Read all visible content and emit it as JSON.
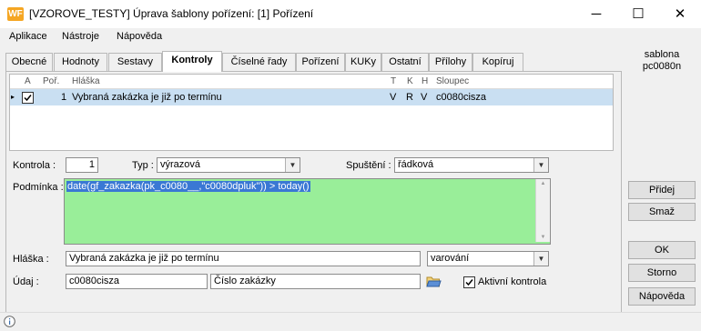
{
  "window": {
    "logo": "WF",
    "title": "[VZOROVE_TESTY] Úprava šablony pořízení: [1] Pořízení",
    "minimize": "─",
    "maximize": "☐",
    "close": "✕"
  },
  "menu": [
    "Aplikace",
    "Nástroje",
    "Nápověda"
  ],
  "tabs": [
    "Obecné",
    "Hodnoty",
    "Sestavy",
    "Kontroly",
    "Číselné řady",
    "Pořízení",
    "KUKy",
    "Ostatní",
    "Přílohy",
    "Kopíruj"
  ],
  "active_tab": "Kontroly",
  "side_info": {
    "line1": "sablona",
    "line2": "pc0080n"
  },
  "grid": {
    "headers": {
      "a": "A",
      "por": "Poř.",
      "hlaska": "Hláška",
      "t": "T",
      "k": "K",
      "h": "H",
      "sloupec": "Sloupec"
    },
    "rows": [
      {
        "marker": "▸",
        "checked": true,
        "por": "1",
        "hlaska": "Vybraná zakázka je již po termínu",
        "t": "V",
        "k": "R",
        "h": "V",
        "sloupec": "c0080cisza"
      }
    ]
  },
  "form": {
    "kontrola_label": "Kontrola :",
    "kontrola_value": "1",
    "typ_label": "Typ :",
    "typ_value": "výrazová",
    "spusteni_label": "Spuštění :",
    "spusteni_value": "řádková",
    "podminka_label": "Podmínka :",
    "podminka_value": "date(gf_zakazka(pk_c0080__,\"c0080dpluk\")) > today()",
    "hlaska_label": "Hláška :",
    "hlaska_value": "Vybraná zakázka je již po termínu",
    "hlaska_type_value": "varování",
    "udaj_label": "Údaj :",
    "udaj_value": "c0080cisza",
    "udaj_desc": "Číslo zakázky",
    "aktivni_label": "Aktivní kontrola",
    "aktivni_checked": true
  },
  "buttons": {
    "pridej": "Přidej",
    "smaz": "Smaž",
    "ok": "OK",
    "storno": "Storno",
    "napoveda": "Nápověda"
  },
  "colors": {
    "condition_bg": "#99ee99",
    "selection": "#3a78d4",
    "row_highlight": "#c9dff2",
    "logo": "#f5a623"
  }
}
